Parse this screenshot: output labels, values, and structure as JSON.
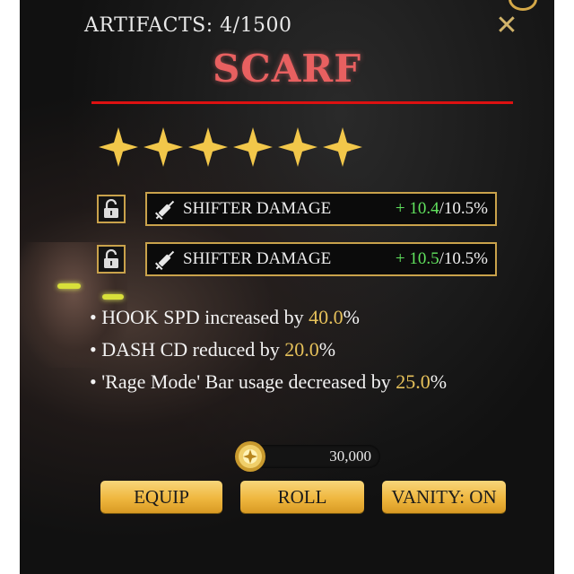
{
  "header": {
    "artifacts_label": "ARTIFACTS: 4/1500",
    "close_glyph": "✕"
  },
  "item": {
    "title": "SCARF",
    "stars": 6,
    "star_color": "#f2c74a"
  },
  "stats": [
    {
      "name": "SHIFTER DAMAGE",
      "current": "+ 10.4",
      "max": "/10.5%",
      "locked": false,
      "icon": "syringe-icon"
    },
    {
      "name": "SHIFTER DAMAGE",
      "current": "+ 10.5",
      "max": "/10.5%",
      "locked": false,
      "icon": "syringe-icon"
    }
  ],
  "effects": [
    {
      "bullet": "•",
      "pre": "HOOK SPD increased by ",
      "value": "40.0",
      "post": "%"
    },
    {
      "bullet": "•",
      "pre": "DASH CD reduced by ",
      "value": "20.0",
      "post": "%"
    },
    {
      "bullet": "•",
      "pre": "'Rage Mode' Bar usage decreased by ",
      "value": "25.0",
      "post": "%"
    }
  ],
  "cost": {
    "amount": "30,000",
    "icon": "gold-coin-icon"
  },
  "buttons": {
    "equip": "EQUIP",
    "roll": "ROLL",
    "vanity": "VANITY: ON"
  },
  "colors": {
    "accent_gold": "#c9a24b",
    "title_red": "#e86060",
    "stat_green": "#61e35e",
    "highlight": "#e6c15a",
    "divider_red": "#dd1111"
  }
}
